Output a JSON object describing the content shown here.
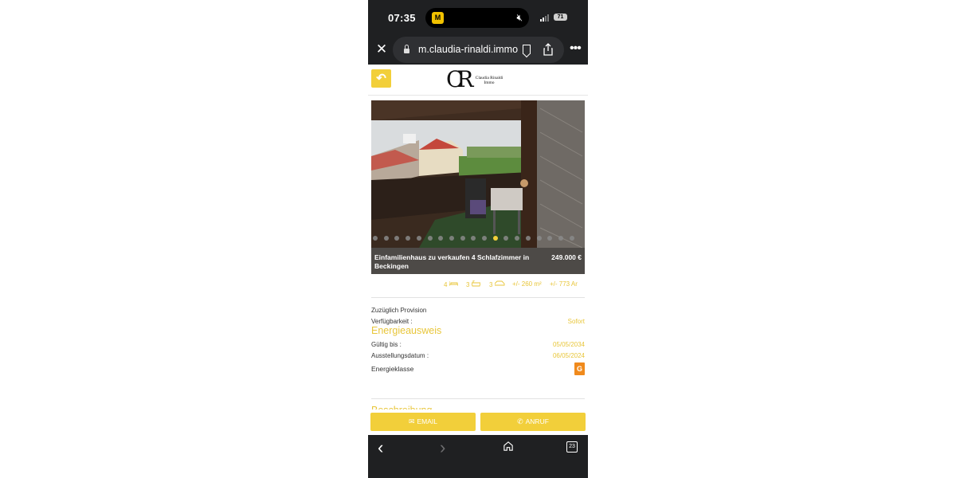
{
  "status_bar": {
    "time": "07:35",
    "battery": "71"
  },
  "browser": {
    "url": "m.claudia-rinaldi.immo"
  },
  "logo": {
    "mark": "CR",
    "name_line1": "Claudia Rinaldi",
    "name_line2": "Immo"
  },
  "carousel": {
    "total_images": 19,
    "active_index": 11
  },
  "listing": {
    "title": "Einfamilienhaus zu verkaufen 4 Schlafzimmer in Beckingen",
    "price": "249.000 €"
  },
  "features": {
    "bedrooms": "4",
    "bathrooms": "3",
    "garages": "3",
    "living_area": "+/- 260 m²",
    "land_area": "+/- 773 Ar"
  },
  "details": {
    "provision": "Zuzüglich Provision",
    "availability_label": "Verfügbarkeit :",
    "availability_value": "Sofort"
  },
  "energy": {
    "section_title": "Energieausweis",
    "valid_until_label": "Gültig bis :",
    "valid_until_value": "05/05/2034",
    "issue_date_label": "Ausstellungsdatum :",
    "issue_date_value": "06/05/2024",
    "class_label": "Energieklasse",
    "class_value": "G",
    "class_color": "#f08a1c"
  },
  "description": {
    "section_title": "Beschreibung"
  },
  "actions": {
    "email_label": "EMAIL",
    "call_label": "ANRUF"
  },
  "colors": {
    "accent": "#f2cf3a",
    "chrome": "#1f2022"
  }
}
